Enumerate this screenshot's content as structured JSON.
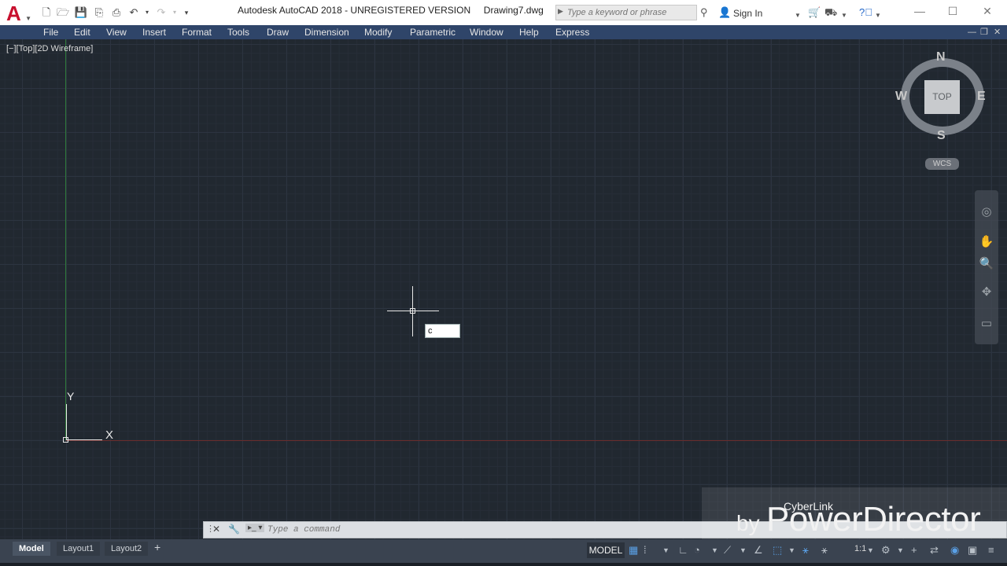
{
  "titlebar": {
    "title": "Autodesk AutoCAD 2018 - UNREGISTERED VERSION     Drawing7.dwg",
    "search_placeholder": "Type a keyword or phrase",
    "sign_in": "Sign In",
    "app_letter": "A"
  },
  "menu": {
    "items": [
      "File",
      "Edit",
      "View",
      "Insert",
      "Format",
      "Tools",
      "Draw",
      "Dimension",
      "Modify",
      "Parametric",
      "Window",
      "Help",
      "Express"
    ]
  },
  "viewport": {
    "label": "[−][Top][2D Wireframe]",
    "ucs_y": "Y",
    "ucs_x": "X",
    "dynamic_input_value": "c"
  },
  "viewcube": {
    "top": "TOP",
    "north": "N",
    "south": "S",
    "east": "E",
    "west": "W",
    "wcs": "WCS"
  },
  "command": {
    "placeholder": "Type a command"
  },
  "watermark": {
    "small": "CyberLink",
    "by": "by",
    "big": "PowerDirector"
  },
  "status": {
    "tabs": [
      "Model",
      "Layout1",
      "Layout2"
    ],
    "add_tab": "+",
    "model": "MODEL",
    "scale": "1:1"
  }
}
